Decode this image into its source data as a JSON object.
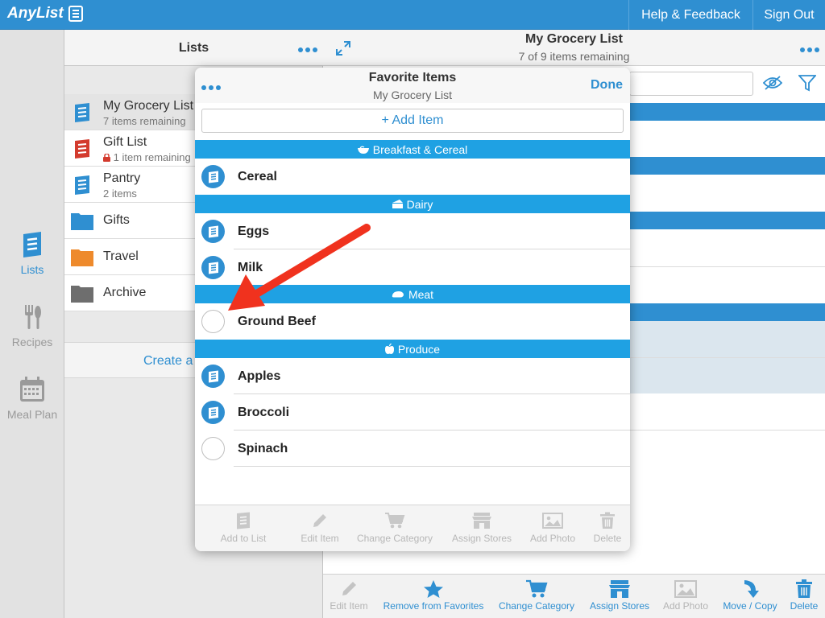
{
  "app": {
    "logo_text": "AnyList",
    "help_label": "Help & Feedback",
    "signout_label": "Sign Out"
  },
  "rail": {
    "items": [
      {
        "label": "Lists",
        "icon": "list-icon",
        "active": true
      },
      {
        "label": "Recipes",
        "icon": "utensils-icon",
        "active": false
      },
      {
        "label": "Meal Plan",
        "icon": "calendar-icon",
        "active": false
      }
    ]
  },
  "lists_panel": {
    "title": "Lists",
    "rows": [
      {
        "name": "My Grocery List",
        "sub": "7 items remaining",
        "icon": "list-icon",
        "color": "#2f8fd1"
      },
      {
        "name": "Gift List",
        "sub": "1 item remaining",
        "icon": "list-icon",
        "color": "#d33b2e",
        "locked": true
      },
      {
        "name": "Pantry",
        "sub": "2 items",
        "icon": "list-icon",
        "color": "#2f8fd1"
      },
      {
        "name": "Gifts",
        "icon": "folder-icon",
        "color": "#2f8fd1"
      },
      {
        "name": "Travel",
        "icon": "folder-icon",
        "color": "#ee8a2c"
      },
      {
        "name": "Archive",
        "icon": "folder-icon",
        "color": "#6e6e6e"
      }
    ],
    "create_label": "Create a"
  },
  "right_panel": {
    "title": "My Grocery List",
    "subtitle": "7 of 9 items remaining",
    "toolbar": [
      {
        "label": "Edit Item",
        "enabled": false,
        "icon": "pencil-icon"
      },
      {
        "label": "Remove from Favorites",
        "enabled": true,
        "icon": "star-icon"
      },
      {
        "label": "Change Category",
        "enabled": true,
        "icon": "cart-icon"
      },
      {
        "label": "Assign Stores",
        "enabled": true,
        "icon": "store-icon"
      },
      {
        "label": "Add Photo",
        "enabled": false,
        "icon": "photo-icon"
      },
      {
        "label": "Move / Copy",
        "enabled": true,
        "icon": "move-icon"
      },
      {
        "label": "Delete",
        "enabled": true,
        "icon": "trash-icon"
      }
    ]
  },
  "popover": {
    "title": "Favorite Items",
    "subtitle": "My Grocery List",
    "done_label": "Done",
    "add_item_label": "+ Add Item",
    "categories": [
      {
        "name": "Breakfast & Cereal",
        "icon": "bowl-icon",
        "items": [
          {
            "name": "Cereal",
            "on_list": true
          }
        ]
      },
      {
        "name": "Dairy",
        "icon": "cheese-icon",
        "items": [
          {
            "name": "Eggs",
            "on_list": true
          },
          {
            "name": "Milk",
            "on_list": true
          }
        ]
      },
      {
        "name": "Meat",
        "icon": "meat-icon",
        "items": [
          {
            "name": "Ground Beef",
            "on_list": false
          }
        ]
      },
      {
        "name": "Produce",
        "icon": "apple-icon",
        "items": [
          {
            "name": "Apples",
            "on_list": true
          },
          {
            "name": "Broccoli",
            "on_list": true
          },
          {
            "name": "Spinach",
            "on_list": false
          }
        ]
      }
    ],
    "toolbar": [
      {
        "label": "Add to List",
        "icon": "list-icon"
      },
      {
        "label": "Edit Item",
        "icon": "pencil-icon"
      },
      {
        "label": "Change Category",
        "icon": "cart-icon"
      },
      {
        "label": "Assign Stores",
        "icon": "store-icon"
      },
      {
        "label": "Add Photo",
        "icon": "photo-icon"
      },
      {
        "label": "Delete",
        "icon": "trash-icon"
      }
    ]
  },
  "colors": {
    "accent": "#2f8fd1",
    "category": "#1fa1e3",
    "arrow": "#f0321e"
  }
}
